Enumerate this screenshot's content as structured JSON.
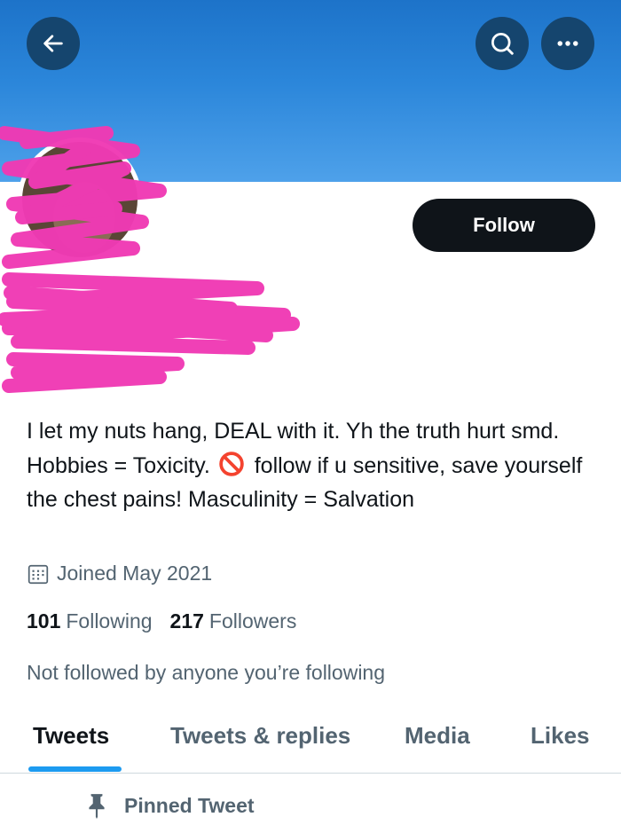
{
  "header": {
    "back_icon": "arrow-left-icon",
    "search_icon": "search-icon",
    "more_icon": "more-dots-icon",
    "banner_color": "#2b86da"
  },
  "profile": {
    "follow_label": "Follow",
    "bio_part1": "I let my nuts hang, DEAL with it. Yh the truth hurt smd. Hobbies = Toxicity.",
    "bio_emoji": "no-entry-icon",
    "bio_part2": "follow if u sensitive, save yourself the chest pains! Masculinity = Salvation",
    "joined": "Joined May 2021",
    "following_count": "101",
    "following_label": "Following",
    "followers_count": "217",
    "followers_label": "Followers",
    "not_followed": "Not followed by anyone you’re following"
  },
  "tabs": [
    {
      "label": "Tweets",
      "active": true
    },
    {
      "label": "Tweets & replies",
      "active": false
    },
    {
      "label": "Media",
      "active": false
    },
    {
      "label": "Likes",
      "active": false
    }
  ],
  "pinned": {
    "label": "Pinned Tweet"
  },
  "colors": {
    "accent": "#1d9bf0",
    "redaction": "#f03ab4",
    "text_primary": "#0f1419",
    "text_secondary": "#536471"
  }
}
